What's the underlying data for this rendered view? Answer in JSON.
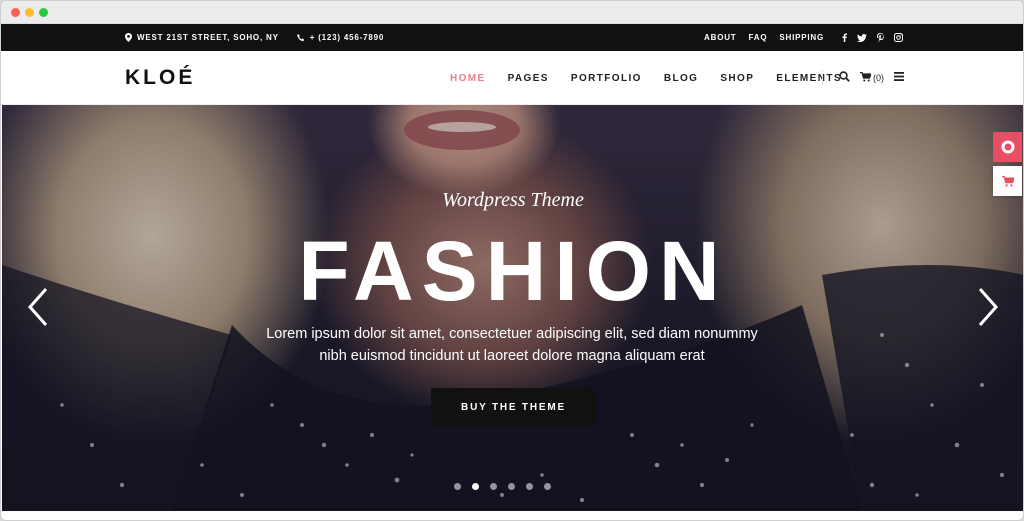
{
  "topbar": {
    "address": "WEST 21ST STREET, SOHO, NY",
    "phone": "+ (123) 456-7890",
    "links": [
      "ABOUT",
      "FAQ",
      "SHIPPING"
    ],
    "social_icons": [
      "facebook-icon",
      "twitter-icon",
      "pinterest-icon",
      "instagram-icon"
    ]
  },
  "nav": {
    "logo": "KLOÉ",
    "menu": [
      "HOME",
      "PAGES",
      "PORTFOLIO",
      "BLOG",
      "SHOP",
      "ELEMENTS"
    ],
    "active": "HOME",
    "cart_count": "(0)"
  },
  "hero": {
    "subtitle": "Wordpress Theme",
    "title": "FASHION",
    "description_line1": "Lorem ipsum dolor sit amet, consectetuer adipiscing elit, sed diam nonummy",
    "description_line2": "nibh euismod tincidunt ut laoreet dolore magna aliquam erat",
    "cta": "BUY THE THEME",
    "slides": 6,
    "active_slide": 2
  },
  "colors": {
    "accent": "#e87f88",
    "side_button": "#e94f64",
    "topbar_bg": "#111111"
  }
}
